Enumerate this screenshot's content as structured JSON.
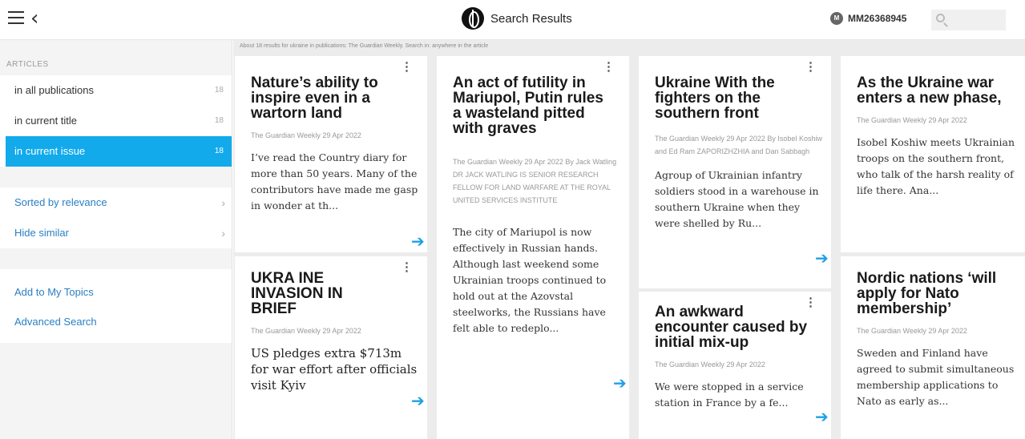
{
  "header": {
    "title": "Search Results",
    "user": "MM26368945",
    "avatar_initial": "M",
    "search_placeholder": ""
  },
  "sidebar": {
    "section_label": "ARTICLES",
    "items": [
      {
        "label": "in all publications",
        "count": "18"
      },
      {
        "label": "in current title",
        "count": "18"
      },
      {
        "label": "in current issue",
        "count": "18",
        "active": true
      }
    ],
    "options": [
      {
        "label": "Sorted by relevance"
      },
      {
        "label": "Hide similar"
      }
    ],
    "links": [
      "Add to My Topics",
      "Advanced Search"
    ]
  },
  "summary": "About 18 results for ukraine in publications: The Guardian Weekly. Search in: anywhere in the article",
  "articles": [
    {
      "title": "Nature’s ability to inspire even in a wartorn land",
      "meta": "The Guardian Weekly  29 Apr 2022",
      "excerpt": "I’ve read the Country diary for more than 50 years. Many of the contributors have made me gasp in wonder at th..."
    },
    {
      "title": "UKRA INE INVASION IN BRIEF",
      "meta": "The Guardian Weekly  29 Apr 2022",
      "excerpt": "US pledges extra $713m for war effort after officials visit Kyiv"
    },
    {
      "title": "An act of futility in Mariupol, Putin rules a wasteland pitted with graves",
      "meta": "The Guardian Weekly  29 Apr 2022  By Jack Watling DR JACK WATLING IS SENIOR RESEARCH FELLOW FOR LAND WARFARE AT THE ROYAL UNITED SERVICES INSTITUTE",
      "excerpt": "The city of Mariupol is now effectively in Russian hands. Although last weekend some Ukrainian troops continued to hold out at the Azovstal steelworks, the Russians have felt able to redeplo..."
    },
    {
      "title": "Ukraine With the fighters on the southern front",
      "meta": "The Guardian Weekly  29 Apr 2022  By Isobel Koshiw and Ed Ram ZAPORIZHZHIA and Dan Sabbagh",
      "excerpt": "Agroup of Ukrainian infantry soldiers stood in a warehouse in southern Ukraine when they were shelled by Ru..."
    },
    {
      "title": "An awkward encounter caused by initial mix-up",
      "meta": "The Guardian Weekly  29 Apr 2022",
      "excerpt": "We were stopped in a service station in France by a fe..."
    },
    {
      "title": "As the Ukraine war enters a new phase,",
      "meta": "The Guardian Weekly  29 Apr 2022",
      "excerpt": "Isobel Koshiw meets Ukrainian troops on the southern front, who talk of the harsh reality of life there. Ana..."
    },
    {
      "title": "Nordic nations ‘will apply for Nato membership’",
      "meta": "The Guardian Weekly  29 Apr 2022",
      "excerpt": "Sweden and Finland have agreed to submit simultaneous membership applications to Nato as early as..."
    }
  ]
}
